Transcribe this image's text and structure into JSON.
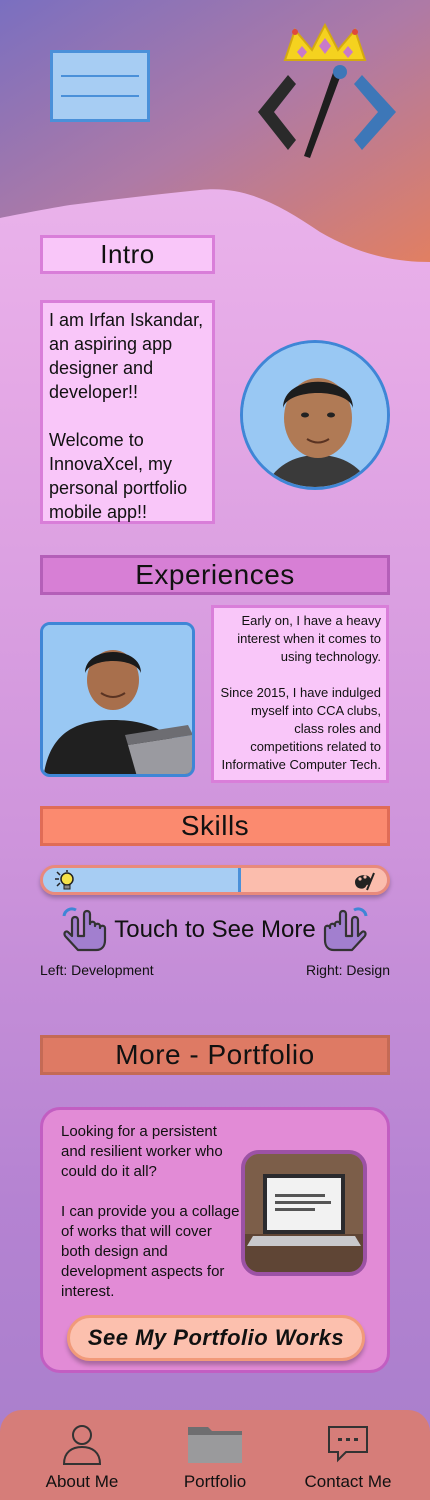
{
  "header": {
    "menu_icon": "menu-icon",
    "logo_icon": "crowned-code-brush-logo"
  },
  "intro": {
    "title": "Intro",
    "text": "I am Irfan Iskandar, an aspiring app designer and developer!!\n\nWelcome to InnovaXcel, my personal portfolio mobile app!!"
  },
  "experiences": {
    "title": "Experiences",
    "text": "Early on, I have a heavy interest when it comes to using technology.\n\nSince 2015, I have indulged myself into CCA clubs, class roles and competitions related to Informative Computer Tech."
  },
  "skills": {
    "title": "Skills",
    "left_icon": "lightbulb-icon",
    "right_icon": "paint-palette-icon",
    "touch_text": "Touch to See More",
    "left_label": "Left: Development",
    "right_label": "Right: Design"
  },
  "more": {
    "title": "More - Portfolio",
    "text": "Looking for a persistent and resilient worker who could do it all?\n\nI can provide you a collage of works that will cover both design and development aspects for interest.",
    "button_label": "See My Portfolio Works"
  },
  "nav": {
    "items": [
      {
        "label": "About Me",
        "icon": "person-icon"
      },
      {
        "label": "Portfolio",
        "icon": "folder-icon"
      },
      {
        "label": "Contact Me",
        "icon": "chat-bubble-icon"
      }
    ]
  },
  "colors": {
    "header_gradient_start": "#7a6fc0",
    "header_gradient_end": "#e17f62",
    "accent_blue": "#4a90d9",
    "pink_card": "#f9c6f9"
  }
}
